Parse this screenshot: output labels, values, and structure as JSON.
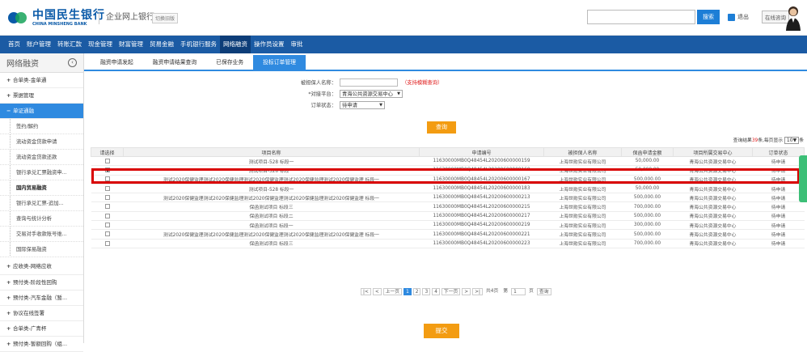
{
  "header": {
    "bank_name": "中国民生银行",
    "bank_name_en": "CHINA MINSHENG BANK",
    "system_name": "企业网上银行",
    "switch_label": "切换旧版",
    "search_button": "搜索",
    "logout": "退出",
    "consult": "在线咨询",
    "brand_color": "#0a5aa8"
  },
  "nav": {
    "items": [
      "首页",
      "账户管理",
      "转账汇款",
      "现金管理",
      "财富管理",
      "贸易金融",
      "手机银行服务",
      "网络融资",
      "操作员设置",
      "审批"
    ],
    "active_index": 7
  },
  "sidebar": {
    "title": "网络融资",
    "collapse_icon": "chevron-left-icon",
    "items": [
      {
        "label": "合单类-金单通",
        "mark": "+"
      },
      {
        "label": "票据管理",
        "mark": "+"
      },
      {
        "label": "单证通融",
        "mark": "−",
        "active": true
      }
    ],
    "subitems": [
      "签约/解约",
      "流动资金贷款申请",
      "流动资金贷款还款",
      "银行承兑汇票融资申...",
      "国内贸易融资",
      "银行承兑汇票-追加...",
      "查询与统计分析",
      "交易对手收款账号维...",
      "国际保易融资"
    ],
    "bottom_items": [
      "应收类-网络应收",
      "预付类-阶段性回购",
      "预付类-汽车金融（暂...",
      "协议在线签署",
      "合单类-广青杯",
      "预付类-暂额回购（组..."
    ]
  },
  "tabs": {
    "items": [
      "融资申请发起",
      "融资申请结果查询",
      "已保存业务",
      "投标订单管理"
    ],
    "active_index": 3
  },
  "form": {
    "guarantee_label": "被担保人名称：",
    "guarantee_value": "",
    "guarantee_hint": "（支持模糊查询）",
    "platform_label": "*对接平台：",
    "platform_value": "青海公共资源交易中心",
    "status_label": "订单状态：",
    "status_value": "待申请",
    "query_button": "查询"
  },
  "summary": {
    "prefix": "查询结果",
    "count": "39",
    "middle": "条,每页显示",
    "page_size": "10",
    "suffix": "条"
  },
  "table": {
    "headers": [
      "请选择",
      "项目名称",
      "申请编号",
      "被担保人名称",
      "保函申请金额",
      "项目所属交易中心",
      "订单状态"
    ],
    "rows": [
      {
        "checked": false,
        "name": "测试项目-528 标段一",
        "no": "11630000MB0Q48454L20200600000159",
        "party": "上海世勋实业有限公司",
        "amount": "50,000.00",
        "center": "青海公共资源交易中心",
        "status": "待申请"
      },
      {
        "checked": true,
        "name": "测试项目-528 标段一",
        "no": "11630000MB0Q48454L20200600000160",
        "party": "上海世勋实业有限公司",
        "amount": "50,000.00",
        "center": "青海公共资源交易中心",
        "status": "待申请"
      },
      {
        "checked": false,
        "name": "测试2020保健监理测试2020保健监理测试2020保健监理测试2020保健监理测试2020保健监理 标段一",
        "no": "11630000MB0Q48454L20200600000167",
        "party": "上海世勋实业有限公司",
        "amount": "500,000.00",
        "center": "青海公共资源交易中心",
        "status": "待申请"
      },
      {
        "checked": false,
        "name": "测试项目-528 标段一",
        "no": "11630000MB0Q48454L20200600000183",
        "party": "上海世勋实业有限公司",
        "amount": "50,000.00",
        "center": "青海公共资源交易中心",
        "status": "待申请"
      },
      {
        "checked": false,
        "name": "测试2020保健监理测试2020保健监理测试2020保健监理测试2020保健监理测试2020保健监理 标段一",
        "no": "11630000MB0Q48454L20200600000213",
        "party": "上海世勋实业有限公司",
        "amount": "500,000.00",
        "center": "青海公共资源交易中心",
        "status": "待申请"
      },
      {
        "checked": false,
        "name": "保函测试项目 标段三",
        "no": "11630000MB0Q48454L20200600000215",
        "party": "上海世勋实业有限公司",
        "amount": "700,000.00",
        "center": "青海公共资源交易中心",
        "status": "待申请"
      },
      {
        "checked": false,
        "name": "保函测试项目 标段二",
        "no": "11630000MB0Q48454L20200600000217",
        "party": "上海世勋实业有限公司",
        "amount": "500,000.00",
        "center": "青海公共资源交易中心",
        "status": "待申请"
      },
      {
        "checked": false,
        "name": "保函测试项目 标段一",
        "no": "11630000MB0Q48454L20200600000219",
        "party": "上海世勋实业有限公司",
        "amount": "300,000.00",
        "center": "青海公共资源交易中心",
        "status": "待申请"
      },
      {
        "checked": false,
        "name": "测试2020保健监理测试2020保健监理测试2020保健监理测试2020保健监理测试2020保健监理 标段一",
        "no": "11630000MB0Q48454L20200600000221",
        "party": "上海世勋实业有限公司",
        "amount": "500,000.00",
        "center": "青海公共资源交易中心",
        "status": "待申请"
      },
      {
        "checked": false,
        "name": "保函测试项目 标段三",
        "no": "11630000MB0Q48454L20200600000223",
        "party": "上海世勋实业有限公司",
        "amount": "700,000.00",
        "center": "青海公共资源交易中心",
        "status": "待申请"
      }
    ]
  },
  "pager": {
    "first": "|<",
    "prev_arrow": "<",
    "prev": "上一页",
    "pages": [
      "1",
      "2",
      "3",
      "4"
    ],
    "current": "1",
    "next": "下一页",
    "next_arrow": ">",
    "last": ">|",
    "total": "共4页",
    "goto_prefix": "第",
    "goto_value": "1",
    "goto_suffix": "页",
    "goto_button": "查询"
  },
  "submit_button": "提交"
}
